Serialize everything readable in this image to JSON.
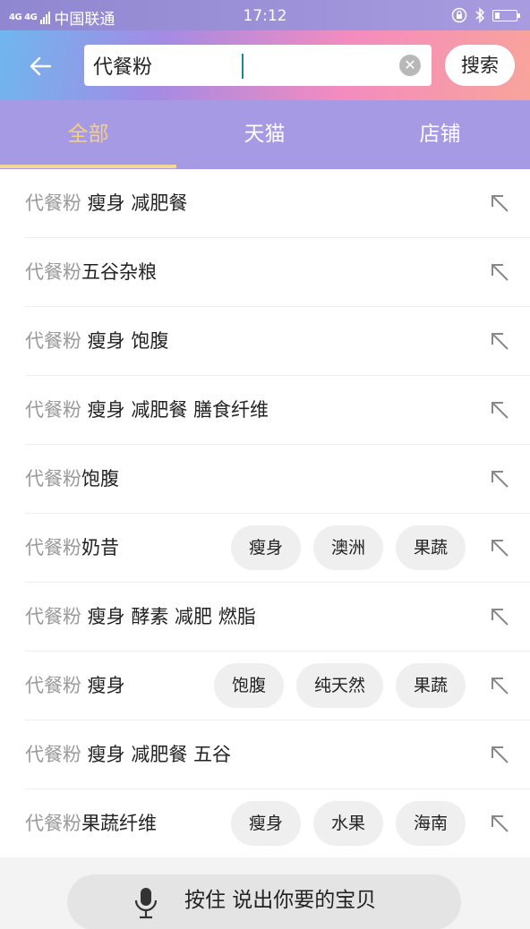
{
  "status_bar": {
    "network": "4G 4G",
    "carrier": "中国联通",
    "time": "17:12"
  },
  "header": {
    "search_value": "代餐粉",
    "search_button": "搜索"
  },
  "tabs": [
    {
      "label": "全部",
      "active": true
    },
    {
      "label": "天猫",
      "active": false
    },
    {
      "label": "店铺",
      "active": false
    }
  ],
  "suggestions": [
    {
      "keyword": "代餐粉",
      "rest": " 瘦身 减肥餐",
      "tags": []
    },
    {
      "keyword": "代餐粉",
      "rest": "五谷杂粮",
      "tags": []
    },
    {
      "keyword": "代餐粉",
      "rest": " 瘦身 饱腹",
      "tags": []
    },
    {
      "keyword": "代餐粉",
      "rest": " 瘦身 减肥餐 膳食纤维",
      "tags": []
    },
    {
      "keyword": "代餐粉",
      "rest": "饱腹",
      "tags": []
    },
    {
      "keyword": "代餐粉",
      "rest": "奶昔",
      "tags": [
        "瘦身",
        "澳洲",
        "果蔬"
      ]
    },
    {
      "keyword": "代餐粉",
      "rest": " 瘦身 酵素 减肥 燃脂",
      "tags": []
    },
    {
      "keyword": "代餐粉",
      "rest": " 瘦身",
      "tags": [
        "饱腹",
        "纯天然",
        "果蔬"
      ]
    },
    {
      "keyword": "代餐粉",
      "rest": " 瘦身 减肥餐 五谷",
      "tags": []
    },
    {
      "keyword": "代餐粉",
      "rest": "果蔬纤维",
      "tags": [
        "瘦身",
        "水果",
        "海南"
      ]
    }
  ],
  "voice": {
    "label": "按住 说出你要的宝贝"
  },
  "colors": {
    "tab_bar": "#a69ae4",
    "active_tab": "#f5d277",
    "keyword_gray": "#999999"
  }
}
